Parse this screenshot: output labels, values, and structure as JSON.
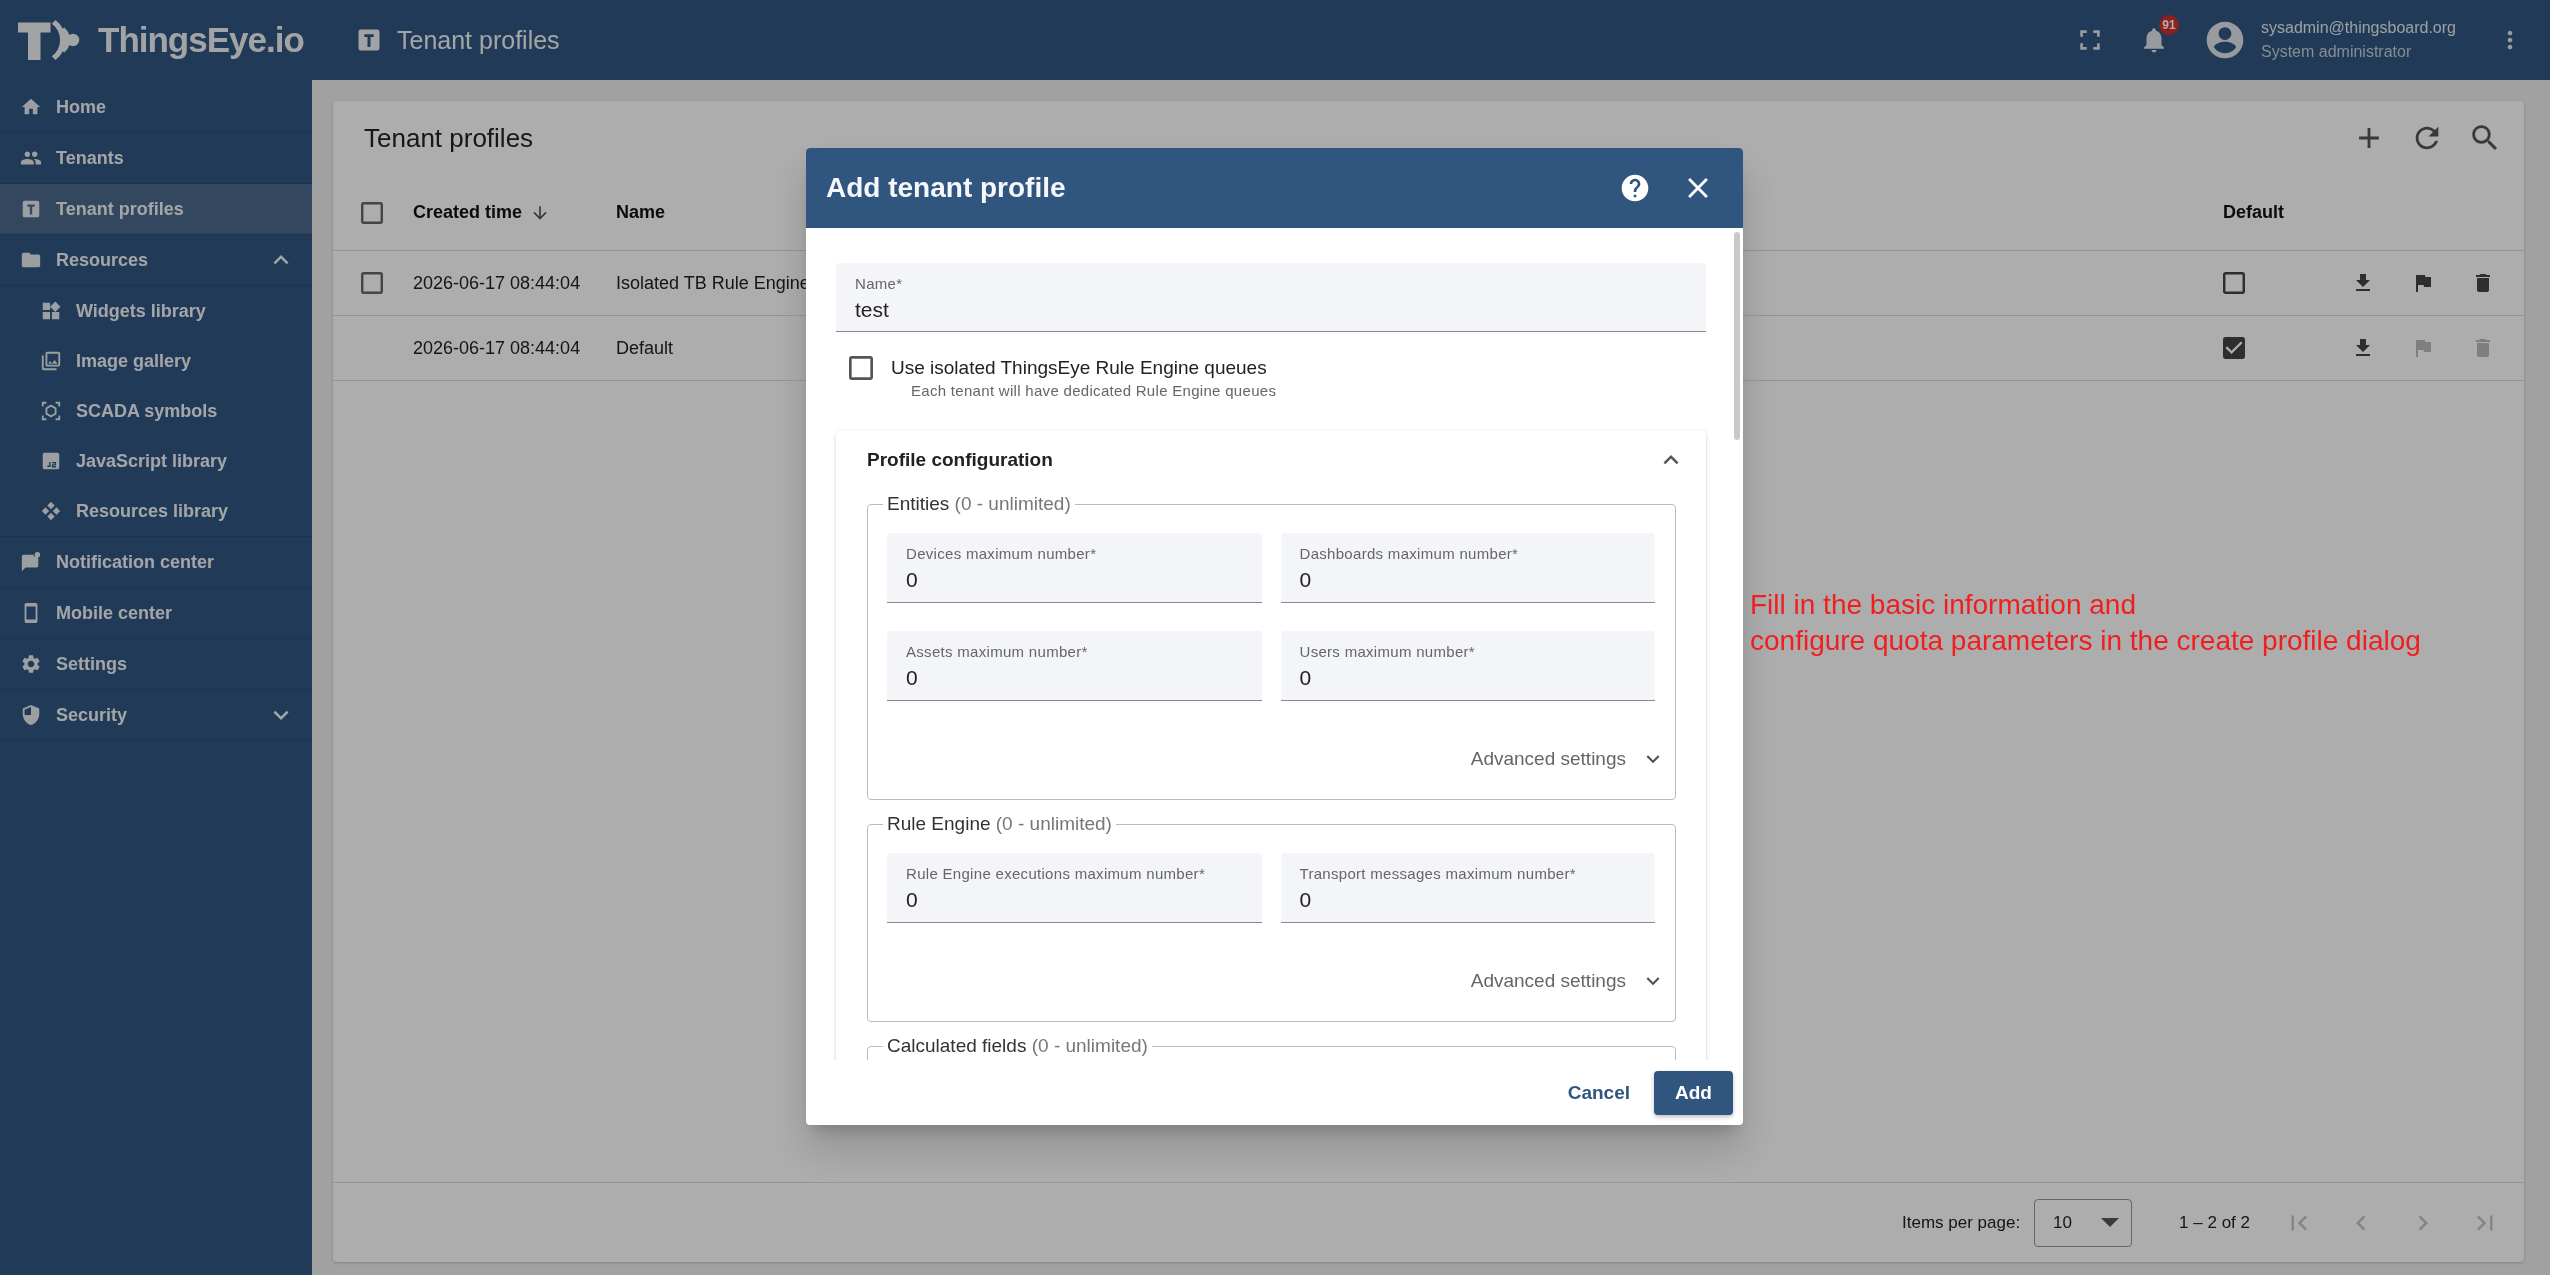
{
  "header": {
    "logo": "ThingsEye.io",
    "page_title": "Tenant profiles",
    "notification_count": "91",
    "user_email": "sysadmin@thingsboard.org",
    "user_role": "System administrator"
  },
  "sidebar": {
    "items": [
      {
        "label": "Home",
        "selected": false
      },
      {
        "label": "Tenants",
        "selected": false
      },
      {
        "label": "Tenant profiles",
        "selected": true
      },
      {
        "label": "Resources",
        "selected": false,
        "expanded": true,
        "children": [
          {
            "label": "Widgets library",
            "selected": false
          },
          {
            "label": "Image gallery",
            "selected": false
          },
          {
            "label": "SCADA symbols",
            "selected": false
          },
          {
            "label": "JavaScript library",
            "selected": false
          },
          {
            "label": "Resources library",
            "selected": false
          }
        ]
      },
      {
        "label": "Notification center",
        "selected": false
      },
      {
        "label": "Mobile center",
        "selected": false
      },
      {
        "label": "Settings",
        "selected": false
      },
      {
        "label": "Security",
        "selected": false,
        "expanded": false
      }
    ]
  },
  "table": {
    "title": "Tenant profiles",
    "all_selected": false,
    "columns": [
      {
        "label": "Created time",
        "sorted": true
      },
      {
        "label": "Name",
        "sorted": false
      },
      {
        "label": "Default",
        "sorted": false
      }
    ],
    "rows": [
      {
        "created_time": "2026-06-17 08:44:04",
        "name": "Isolated TB Rule Engine",
        "selectable": true,
        "selected": false,
        "default": false,
        "actions": [
          {
            "kind": "download",
            "disabled": false
          },
          {
            "kind": "flag",
            "disabled": false
          },
          {
            "kind": "delete",
            "disabled": false
          }
        ]
      },
      {
        "created_time": "2026-06-17 08:44:04",
        "name": "Default",
        "selectable": false,
        "default": true,
        "actions": [
          {
            "kind": "download",
            "disabled": false
          },
          {
            "kind": "flag",
            "disabled": true
          },
          {
            "kind": "delete",
            "disabled": true
          }
        ]
      }
    ],
    "pagination": {
      "label": "Items per page:",
      "page_size": "10",
      "range": "1 – 2 of 2",
      "nav": [
        {
          "kind": "first",
          "disabled": true
        },
        {
          "kind": "previous",
          "disabled": true
        },
        {
          "kind": "next",
          "disabled": true
        },
        {
          "kind": "last",
          "disabled": true
        }
      ]
    }
  },
  "dialog": {
    "title": "Add tenant profile",
    "name_field": {
      "label": "Name*",
      "value": "test"
    },
    "isolated_queues": {
      "label": "Use isolated ThingsEye Rule Engine queues",
      "hint": "Each tenant will have dedicated Rule Engine queues",
      "checked": false
    },
    "profile_configuration": {
      "title": "Profile configuration",
      "expanded": true,
      "sections": [
        {
          "title": "Entities",
          "note": "(0 - unlimited)",
          "fields": [
            {
              "label": "Devices maximum number*",
              "value": "0"
            },
            {
              "label": "Dashboards maximum number*",
              "value": "0"
            },
            {
              "label": "Assets maximum number*",
              "value": "0"
            },
            {
              "label": "Users maximum number*",
              "value": "0"
            }
          ],
          "advanced_label": "Advanced settings",
          "advanced_expanded": false
        },
        {
          "title": "Rule Engine",
          "note": "(0 - unlimited)",
          "fields": [
            {
              "label": "Rule Engine executions maximum number*",
              "value": "0"
            },
            {
              "label": "Transport messages maximum number*",
              "value": "0"
            }
          ],
          "advanced_label": "Advanced settings",
          "advanced_expanded": false
        },
        {
          "title": "Calculated fields",
          "note": "(0 - unlimited)"
        }
      ]
    },
    "buttons": {
      "cancel": "Cancel",
      "add": "Add"
    }
  },
  "annotation": {
    "lines": [
      "Fill in the basic information and",
      "configure quota parameters in the create profile dialog"
    ]
  }
}
